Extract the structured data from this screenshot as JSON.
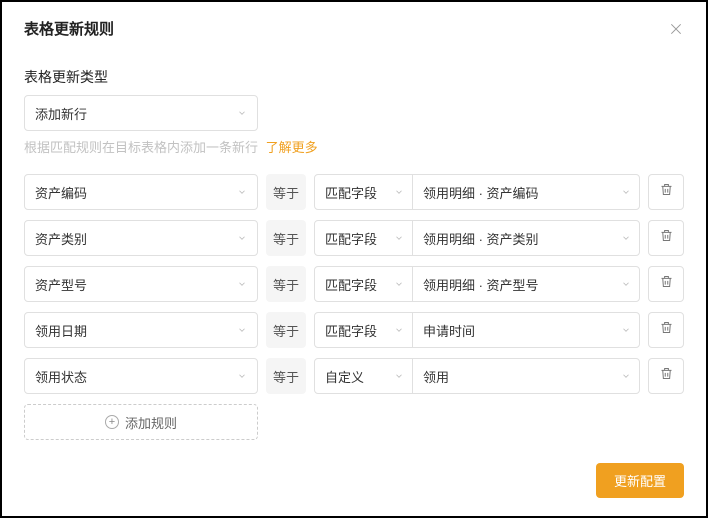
{
  "modal": {
    "title": "表格更新规则",
    "close": "close"
  },
  "section": {
    "type_label": "表格更新类型",
    "type_value": "添加新行",
    "hint_text": "根据匹配规则在目标表格内添加一条新行",
    "hint_link": "了解更多"
  },
  "ops": {
    "equals": "等于"
  },
  "rules": [
    {
      "field": "资产编码",
      "val_type": "匹配字段",
      "val_field": "领用明细 · 资产编码"
    },
    {
      "field": "资产类别",
      "val_type": "匹配字段",
      "val_field": "领用明细 · 资产类别"
    },
    {
      "field": "资产型号",
      "val_type": "匹配字段",
      "val_field": "领用明细 · 资产型号"
    },
    {
      "field": "领用日期",
      "val_type": "匹配字段",
      "val_field": "申请时间"
    },
    {
      "field": "领用状态",
      "val_type": "自定义",
      "val_field": "领用"
    }
  ],
  "add_rule_label": "添加规则",
  "footer": {
    "submit": "更新配置"
  }
}
